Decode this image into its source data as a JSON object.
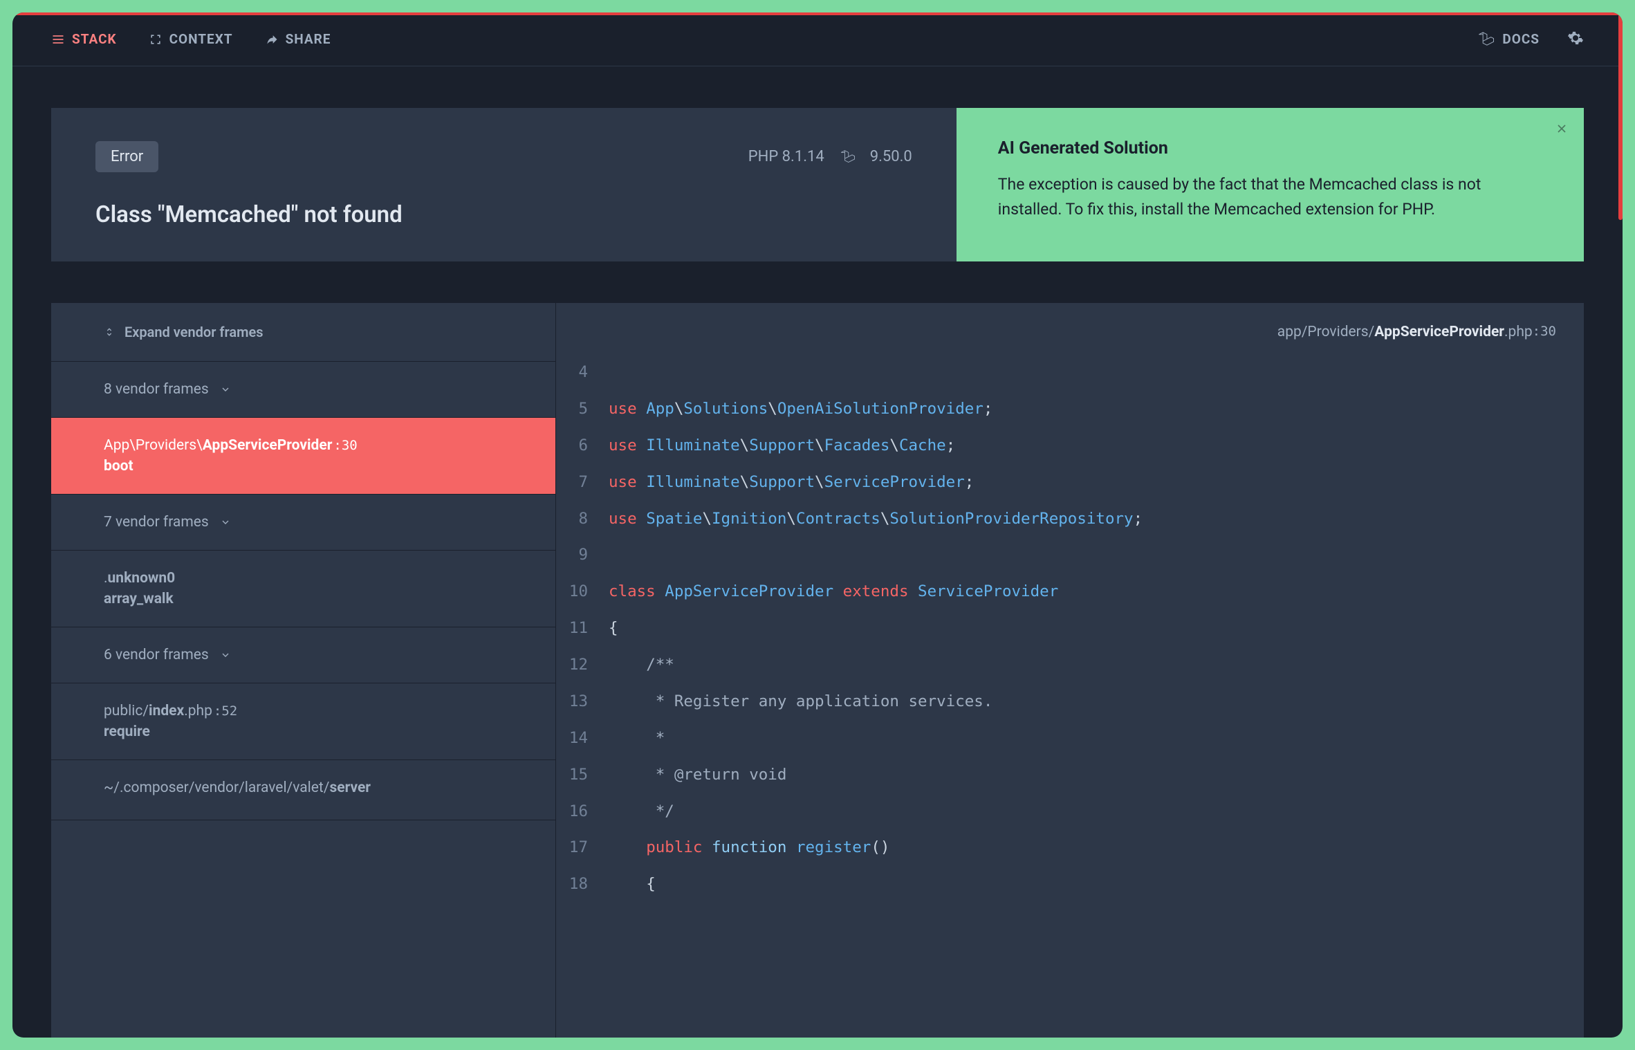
{
  "header": {
    "tabs": {
      "stack": "STACK",
      "context": "CONTEXT",
      "share": "SHARE"
    },
    "docs": "DOCS"
  },
  "error": {
    "badge": "Error",
    "php_version": "PHP 8.1.14",
    "framework_version": "9.50.0",
    "title": "Class \"Memcached\" not found"
  },
  "solution": {
    "title": "AI Generated Solution",
    "body": "The exception is caused by the fact that the Memcached class is not installed. To fix this, install the Memcached extension for PHP."
  },
  "frames": {
    "expand_label": "Expand vendor frames",
    "items": [
      {
        "type": "vendor",
        "label": "8 vendor frames"
      },
      {
        "type": "frame",
        "active": true,
        "path_prefix": "App\\Providers\\",
        "path_bold": "AppServiceProvider",
        "line": ":30",
        "method": "boot"
      },
      {
        "type": "vendor",
        "label": "7 vendor frames"
      },
      {
        "type": "frame",
        "path_prefix": ".",
        "path_bold": "unknown0",
        "line": "",
        "method": "array_walk"
      },
      {
        "type": "vendor",
        "label": "6 vendor frames"
      },
      {
        "type": "frame",
        "path_prefix": "public/",
        "path_bold": "index",
        "path_suffix": ".php",
        "line": ":52",
        "method": "require"
      },
      {
        "type": "frame",
        "path_prefix": "~/.composer/vendor/laravel/valet/",
        "path_bold": "server",
        "line": "",
        "method": ""
      }
    ]
  },
  "code": {
    "path_prefix": "app/Providers/",
    "path_bold": "AppServiceProvider",
    "path_suffix": ".php",
    "line": ":30",
    "lines": [
      {
        "n": 4,
        "html": ""
      },
      {
        "n": 5,
        "html": "<span class='tok-kw'>use</span> <span class='tok-ns'>App</span><span class='tok-punct'>\\</span><span class='tok-ns'>Solutions</span><span class='tok-punct'>\\</span><span class='tok-cls'>OpenAiSolutionProvider</span><span class='tok-punct'>;</span>"
      },
      {
        "n": 6,
        "html": "<span class='tok-kw'>use</span> <span class='tok-ns'>Illuminate</span><span class='tok-punct'>\\</span><span class='tok-ns'>Support</span><span class='tok-punct'>\\</span><span class='tok-ns'>Facades</span><span class='tok-punct'>\\</span><span class='tok-cls'>Cache</span><span class='tok-punct'>;</span>"
      },
      {
        "n": 7,
        "html": "<span class='tok-kw'>use</span> <span class='tok-ns'>Illuminate</span><span class='tok-punct'>\\</span><span class='tok-ns'>Support</span><span class='tok-punct'>\\</span><span class='tok-cls'>ServiceProvider</span><span class='tok-punct'>;</span>"
      },
      {
        "n": 8,
        "html": "<span class='tok-kw'>use</span> <span class='tok-ns'>Spatie</span><span class='tok-punct'>\\</span><span class='tok-ns'>Ignition</span><span class='tok-punct'>\\</span><span class='tok-ns'>Contracts</span><span class='tok-punct'>\\</span><span class='tok-cls'>SolutionProviderRepository</span><span class='tok-punct'>;</span>"
      },
      {
        "n": 9,
        "html": ""
      },
      {
        "n": 10,
        "html": "<span class='tok-kw'>class</span> <span class='tok-cls'>AppServiceProvider</span> <span class='tok-kw'>extends</span> <span class='tok-cls'>ServiceProvider</span>"
      },
      {
        "n": 11,
        "html": "<span class='tok-punct'>{</span>"
      },
      {
        "n": 12,
        "html": "    <span class='tok-comment'>/**</span>"
      },
      {
        "n": 13,
        "html": "    <span class='tok-comment'> * Register any application services.</span>"
      },
      {
        "n": 14,
        "html": "    <span class='tok-comment'> *</span>"
      },
      {
        "n": 15,
        "html": "    <span class='tok-comment'> * @return void</span>"
      },
      {
        "n": 16,
        "html": "    <span class='tok-comment'> */</span>"
      },
      {
        "n": 17,
        "html": "    <span class='tok-kw'>public</span> <span class='tok-fn'>function</span> <span class='tok-name'>register</span><span class='tok-punct'>()</span>"
      },
      {
        "n": 18,
        "html": "    <span class='tok-punct'>{</span>"
      }
    ]
  }
}
